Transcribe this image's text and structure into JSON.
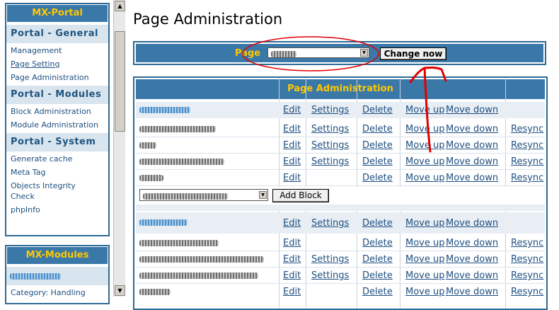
{
  "nav": {
    "title": "MX-Portal",
    "sections": [
      {
        "title": "Portal - General",
        "items": [
          "Management",
          "Page Setting",
          "Page Administration"
        ]
      },
      {
        "title": "Portal - Modules",
        "items": [
          "Block Administration",
          "Module Administration"
        ]
      },
      {
        "title": "Portal - System",
        "items": [
          "Generate cache",
          "Meta Tag",
          "Objects Integrity Check",
          "phpInfo"
        ]
      }
    ],
    "modules_title": "MX-Modules",
    "modules_items": [
      "Category: Handling"
    ]
  },
  "main": {
    "title": "Page Administration",
    "page_label": "Page",
    "change_button": "Change now",
    "table_title": "Page Administration",
    "actions": {
      "edit": "Edit",
      "settings": "Settings",
      "delete": "Delete",
      "move_up": "Move up",
      "move_down": "Move down",
      "resync": "Resync"
    },
    "add_block": "Add Block"
  },
  "colors": {
    "brand": "#3a78a8",
    "accent": "#ffc800",
    "annotation": "#e00000"
  }
}
